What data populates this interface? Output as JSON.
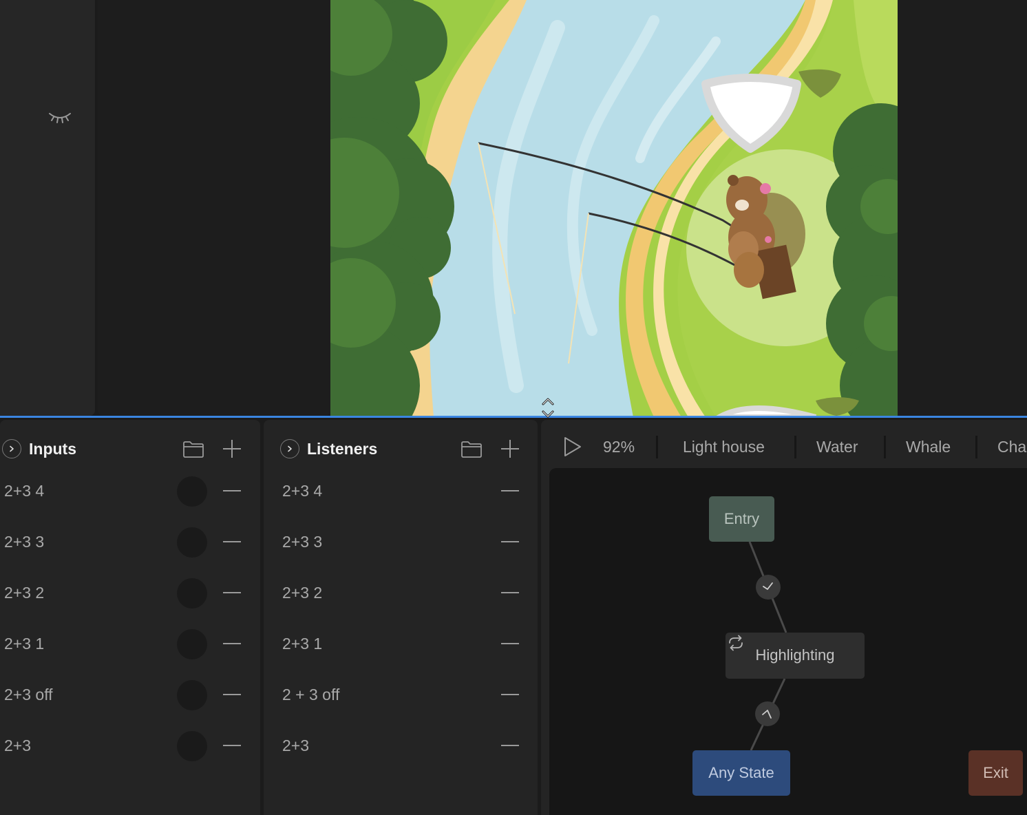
{
  "inputs_panel": {
    "title": "Inputs",
    "items": [
      {
        "label": "2+3 4"
      },
      {
        "label": "2+3 3"
      },
      {
        "label": "2+3 2"
      },
      {
        "label": "2+3 1"
      },
      {
        "label": "2+3 off"
      },
      {
        "label": "2+3"
      }
    ]
  },
  "listeners_panel": {
    "title": "Listeners",
    "items": [
      {
        "label": "2+3 4"
      },
      {
        "label": "2+3 3"
      },
      {
        "label": "2+3 2"
      },
      {
        "label": "2+3 1"
      },
      {
        "label": "2 + 3 off"
      },
      {
        "label": "2+3"
      }
    ]
  },
  "state_machine": {
    "zoom": "92%",
    "tabs": [
      "Light house",
      "Water",
      "Whale",
      "Cha"
    ],
    "nodes": {
      "entry": "Entry",
      "highlighting": "Highlighting",
      "any_state": "Any State",
      "exit": "Exit"
    }
  },
  "colors": {
    "accent": "#3a85e0",
    "entry": "#485b52",
    "any_state": "#2d4b7c",
    "exit": "#5a3126",
    "panel": "#242424"
  },
  "icons": [
    "eye-closed-icon",
    "chevron-right-icon",
    "folder-icon",
    "plus-icon",
    "minus-icon",
    "play-icon",
    "loop-icon",
    "resize-icon"
  ]
}
